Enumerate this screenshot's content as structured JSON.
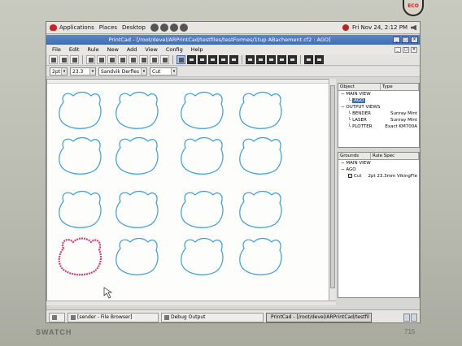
{
  "bezel": {
    "brand": "SWATCH",
    "model": "715",
    "sticker": "ECO"
  },
  "panel": {
    "menus": [
      "Applications",
      "Places",
      "Desktop"
    ],
    "datetime": "Fri Nov 24,  2:12 PM"
  },
  "window": {
    "title": "PrintCad - [/root/devel/ARPrintCad/testfiles/testFormes/1tup ABachement.cf2 : AGO]",
    "menu": [
      "File",
      "Edit",
      "Rule",
      "New",
      "Add",
      "View",
      "Config",
      "Help"
    ]
  },
  "propbar": {
    "width_value": "2pt",
    "height_value": "23.3",
    "tool_value": "Sandvik Derfles",
    "type_value": "Cut"
  },
  "object_panel": {
    "col_object": "Object",
    "col_type": "Type",
    "rows": [
      {
        "label": "MAIN VIEW",
        "value": "",
        "indent": 0
      },
      {
        "label": "AGO",
        "value": "",
        "indent": 1,
        "selected": true
      },
      {
        "label": "OUTPUT VIEWS",
        "value": "",
        "indent": 0
      },
      {
        "label": "BENDER",
        "value": "Sunray Mint",
        "indent": 1
      },
      {
        "label": "LASER",
        "value": "Sunray Mint",
        "indent": 1
      },
      {
        "label": "PLOTTER",
        "value": "Exact KM700A",
        "indent": 1
      }
    ]
  },
  "grounds_panel": {
    "col_grounds": "Grounds",
    "col_rule": "Rule Spec",
    "rows": [
      {
        "label": "MAIN VIEW",
        "value": ""
      },
      {
        "label": "AGO",
        "value": ""
      },
      {
        "label": "Cut",
        "value": "2pt 23.3mm VikingFle"
      }
    ]
  },
  "taskbar": {
    "tasks": [
      "[sender - File Browser]",
      "Debug Output",
      "PrintCad - [/root/devel/ARPrintCad/testfil"
    ]
  },
  "colors": {
    "shape_outline": "#3a9fd8",
    "shape_selected": "#d0407a",
    "title_bar": "#3f6db4"
  },
  "grid": {
    "rows": 4,
    "cols": 4,
    "selected_index": 12
  }
}
